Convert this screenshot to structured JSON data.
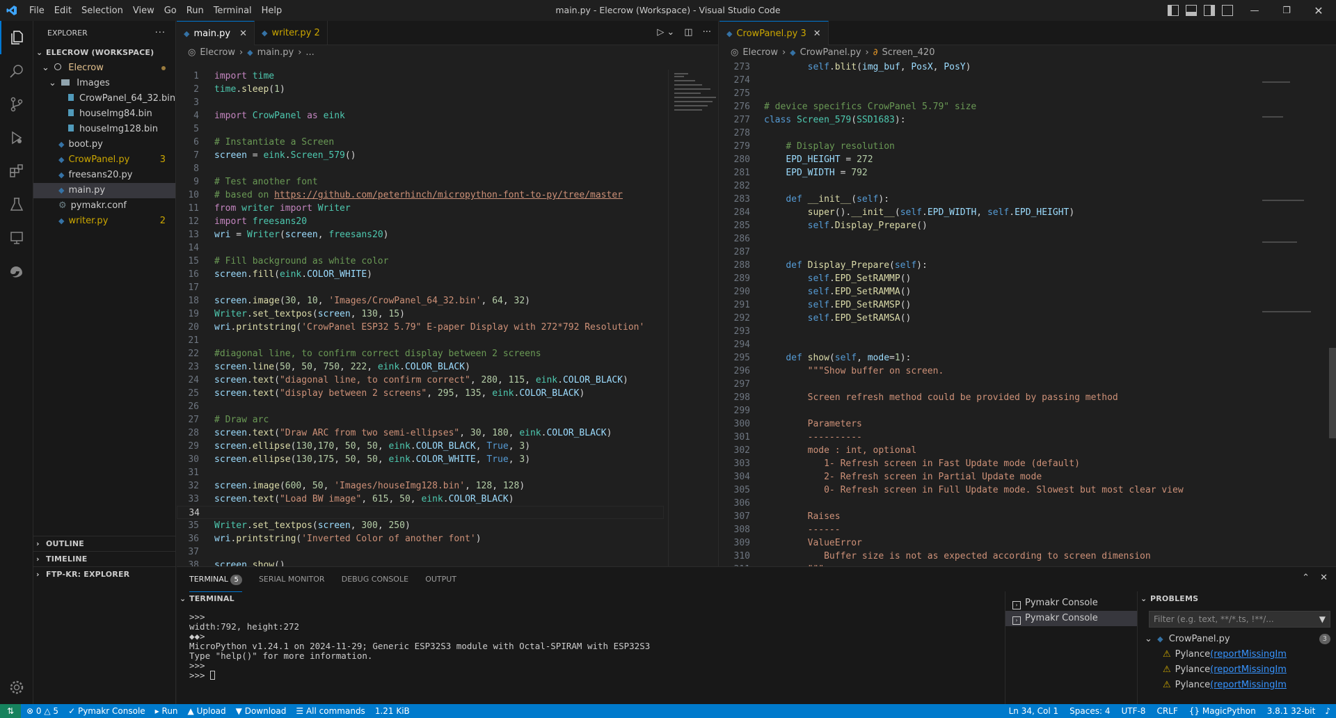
{
  "titlebar": {
    "menu": [
      "File",
      "Edit",
      "Selection",
      "View",
      "Go",
      "Run",
      "Terminal",
      "Help"
    ],
    "title": "main.py - Elecrow (Workspace) - Visual Studio Code"
  },
  "activity": [
    "explorer-icon",
    "search-icon",
    "source-control-icon",
    "run-debug-icon",
    "extensions-icon",
    "testing-icon",
    "remote-explorer-icon",
    "edge-icon"
  ],
  "sidebar": {
    "title": "EXPLORER",
    "workspace": "ELECROW (WORKSPACE)",
    "folder": "Elecrow",
    "subfolder": "Images",
    "images": [
      "CrowPanel_64_32.bin",
      "houseImg84.bin",
      "houseImg128.bin"
    ],
    "files": [
      {
        "name": "boot.py",
        "badge": ""
      },
      {
        "name": "CrowPanel.py",
        "badge": "3"
      },
      {
        "name": "freesans20.py",
        "badge": ""
      },
      {
        "name": "main.py",
        "badge": ""
      },
      {
        "name": "pymakr.conf",
        "badge": ""
      },
      {
        "name": "writer.py",
        "badge": "2"
      }
    ],
    "outline": "OUTLINE",
    "timeline": "TIMELINE",
    "ftp": "FTP-KR: EXPLORER"
  },
  "left_editor": {
    "tabs": [
      {
        "label": "main.py"
      },
      {
        "label": "writer.py",
        "badge": "2"
      }
    ],
    "breadcrumb": [
      "Elecrow",
      "main.py",
      "..."
    ],
    "first_line": 1,
    "current_line": 34
  },
  "right_editor": {
    "tabs": [
      {
        "label": "CrowPanel.py",
        "badge": "3"
      }
    ],
    "breadcrumb": [
      "Elecrow",
      "CrowPanel.py",
      "Screen_420"
    ],
    "first_line": 273
  },
  "panel": {
    "tabs": [
      "TERMINAL",
      "SERIAL MONITOR",
      "DEBUG CONSOLE",
      "OUTPUT"
    ],
    "terminal_badge": "5",
    "terminal_header": "TERMINAL",
    "terminal_lines": [
      ">>>",
      "width:792, height:272",
      "◆◆>",
      "MicroPython v1.24.1 on 2024-11-29; Generic ESP32S3 module with Octal-SPIRAM with ESP32S3",
      "Type \"help()\" for more information.",
      ">>>",
      ">>> "
    ],
    "consoles": [
      "Pymakr Console",
      "Pymakr Console"
    ],
    "problems_title": "PROBLEMS",
    "problems_filter": "Filter (e.g. text, **/*.ts, !**/...",
    "problems_file": "CrowPanel.py",
    "problems_count": "3",
    "problems": [
      {
        "source": "Pylance",
        "code": "(reportMissingIm"
      },
      {
        "source": "Pylance",
        "code": "(reportMissingIm"
      },
      {
        "source": "Pylance",
        "code": "(reportMissingIm"
      }
    ]
  },
  "statusbar": {
    "errors": "0",
    "warnings": "5",
    "pymakr": "Pymakr Console",
    "run": "Run",
    "upload": "Upload",
    "download": "Download",
    "commands": "All commands",
    "size": "1.21 KiB",
    "position": "Ln 34, Col 1",
    "spaces": "Spaces: 4",
    "encoding": "UTF-8",
    "eol": "CRLF",
    "language": "MagicPython",
    "interpreter": "3.8.1 32-bit"
  }
}
